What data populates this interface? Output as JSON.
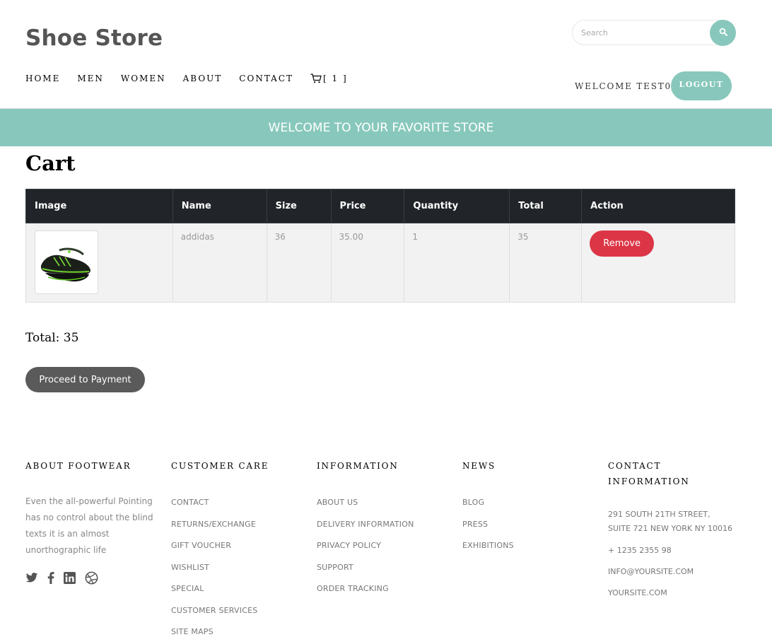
{
  "header": {
    "brand": "Shoe Store",
    "search": {
      "placeholder": "Search",
      "icon": "search-icon"
    },
    "nav": [
      {
        "label": "HOME"
      },
      {
        "label": "MEN"
      },
      {
        "label": "WOMEN"
      },
      {
        "label": "ABOUT"
      },
      {
        "label": "CONTACT"
      }
    ],
    "cart": {
      "icon": "cart-icon",
      "label": "[ 1 ]"
    },
    "welcome": "WELCOME TEST0",
    "logout_label": "LOGOUT"
  },
  "banner": {
    "text": "WELCOME TO YOUR FAVORITE STORE"
  },
  "colors": {
    "accent": "#88c8bc",
    "table_header": "#212529",
    "danger": "#dc3545",
    "pay_button": "#5a5a5a"
  },
  "main": {
    "title": "Cart",
    "table": {
      "headers": [
        "Image",
        "Name",
        "Size",
        "Price",
        "Quantity",
        "Total",
        "Action"
      ],
      "rows": [
        {
          "image": "sneaker-image",
          "name": "addidas",
          "size": "36",
          "price": "35.00",
          "quantity": "1",
          "total": "35",
          "action_label": "Remove"
        }
      ]
    },
    "total_label": "Total: 35",
    "pay_label": "Proceed to Payment"
  },
  "footer": {
    "about": {
      "heading": "ABOUT FOOTWEAR",
      "text": "Even the all-powerful Pointing has no control about the blind texts it is an almost unorthographic life",
      "social": [
        "twitter-icon",
        "facebook-icon",
        "linkedin-icon",
        "dribbble-icon"
      ]
    },
    "customer_care": {
      "heading": "CUSTOMER CARE",
      "links": [
        "CONTACT",
        "RETURNS/EXCHANGE",
        "GIFT VOUCHER",
        "WISHLIST",
        "SPECIAL",
        "CUSTOMER SERVICES",
        "SITE MAPS"
      ]
    },
    "information": {
      "heading": "INFORMATION",
      "links": [
        "ABOUT US",
        "DELIVERY INFORMATION",
        "PRIVACY POLICY",
        "SUPPORT",
        "ORDER TRACKING"
      ]
    },
    "news": {
      "heading": "NEWS",
      "links": [
        "BLOG",
        "PRESS",
        "EXHIBITIONS"
      ]
    },
    "contact": {
      "heading_line1": "CONTACT",
      "heading_line2": "INFORMATION",
      "address_line1": "291 SOUTH 21TH STREET,",
      "address_line2": "SUITE 721 NEW YORK NY 10016",
      "phone": "+ 1235 2355 98",
      "email": "INFO@YOURSITE.COM",
      "website": "YOURSITE.COM"
    }
  }
}
